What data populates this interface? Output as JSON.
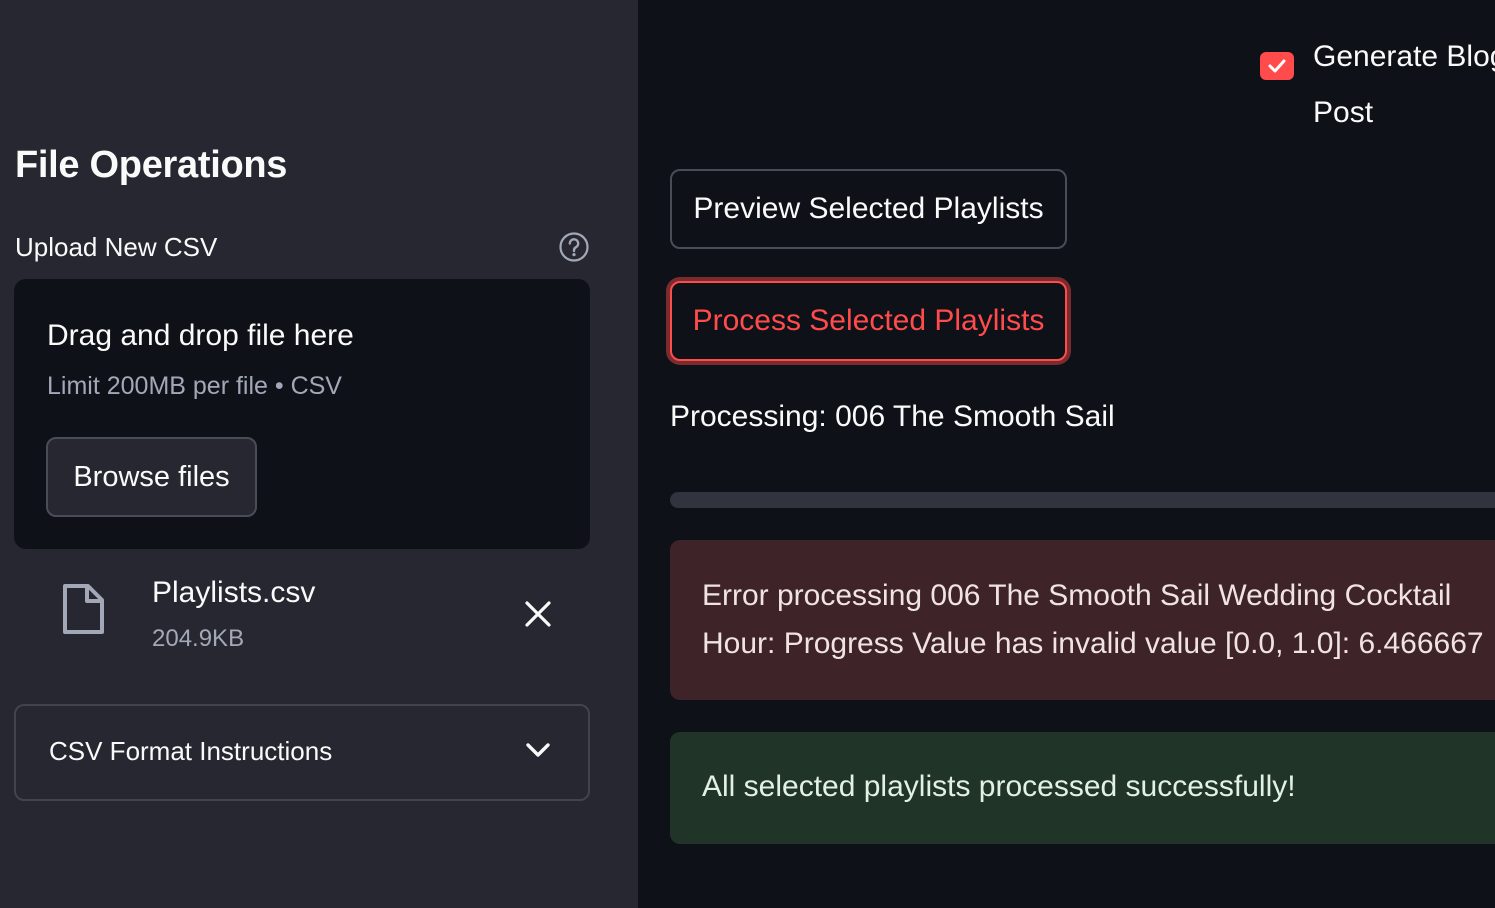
{
  "sidebar": {
    "title": "File Operations",
    "uploader": {
      "label": "Upload New CSV",
      "drop_title": "Drag and drop file here",
      "drop_subtitle": "Limit 200MB per file • CSV",
      "browse_label": "Browse files"
    },
    "uploaded_file": {
      "name": "Playlists.csv",
      "size": "204.9KB"
    },
    "expander": {
      "label": "CSV Format Instructions"
    }
  },
  "main": {
    "checkbox": {
      "label_line1": "Generate Blog",
      "label_line2": "Post",
      "checked": true
    },
    "preview_button": "Preview Selected Playlists",
    "process_button": "Process Selected Playlists",
    "processing_text": "Processing: 006 The Smooth Sail",
    "progress": 0,
    "error_message": "Error processing 006 The Smooth Sail Wedding Cocktail Hour: Progress Value has invalid value [0.0, 1.0]: 6.466667",
    "success_message": "All selected playlists processed successfully!"
  },
  "colors": {
    "sidebar_bg": "#262730",
    "main_bg": "#0e1117",
    "accent": "#ff4b4b",
    "error_bg": "#3e2328",
    "success_bg": "#203528"
  },
  "icons": [
    "help-icon",
    "file-icon",
    "close-icon",
    "chevron-down-icon",
    "checkmark-icon"
  ]
}
